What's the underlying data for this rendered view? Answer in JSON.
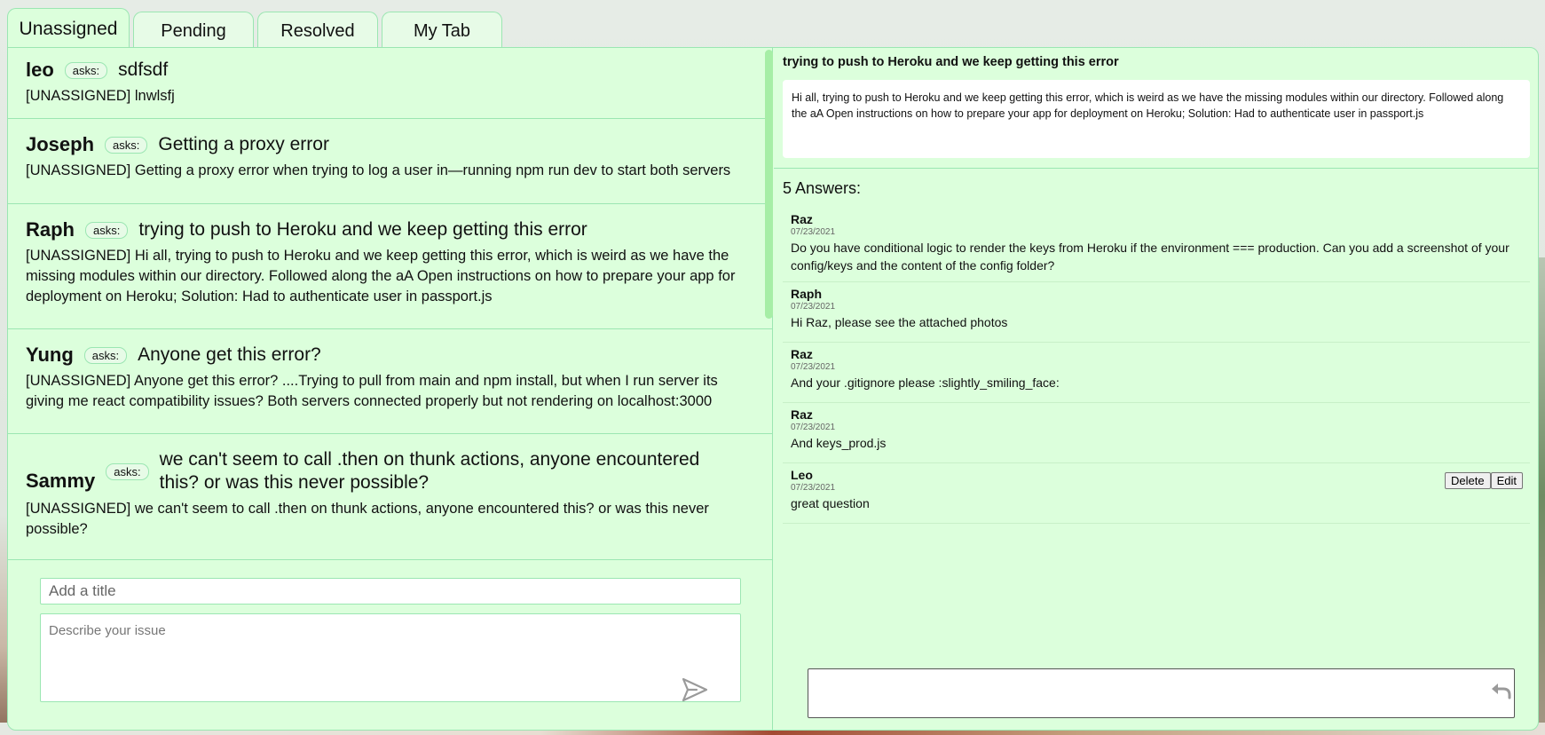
{
  "tabs": [
    {
      "label": "Unassigned",
      "active": true
    },
    {
      "label": "Pending"
    },
    {
      "label": "Resolved"
    },
    {
      "label": "My Tab"
    }
  ],
  "questions": [
    {
      "name": "leo",
      "asks": "asks:",
      "title": "sdfsdf",
      "body": "[UNASSIGNED] lnwlsfj"
    },
    {
      "name": "Joseph",
      "asks": "asks:",
      "title": "Getting a proxy error",
      "body": "[UNASSIGNED] Getting a proxy error when trying to log a user in—running npm run dev to start both servers"
    },
    {
      "name": "Raph",
      "asks": "asks:",
      "title": "trying to push to Heroku and we keep getting this error",
      "body": "[UNASSIGNED] Hi all, trying to push to Heroku and we keep getting this error, which is weird as we have the missing modules within our directory. Followed along the aA Open instructions on how to prepare your app for deployment on Heroku; Solution: Had to authenticate user in passport.js"
    },
    {
      "name": "Yung",
      "asks": "asks:",
      "title": "Anyone get this error?",
      "body": "[UNASSIGNED] Anyone get this error? ....Trying to pull from main and npm install, but when I run server its giving me react compatibility issues? Both servers connected properly but not rendering on localhost:3000"
    },
    {
      "name": "Sammy",
      "asks": "asks:",
      "title": "we can't seem to call .then on thunk actions, anyone encountered this? or was this never possible?",
      "body": "[UNASSIGNED] we can't seem to call .then on thunk actions, anyone encountered this? or was this never possible?"
    }
  ],
  "composer": {
    "title_placeholder": "Add a title",
    "desc_placeholder": "Describe your issue"
  },
  "detail": {
    "title": "trying to push to Heroku and we keep getting this error",
    "body": "Hi all, trying to push to Heroku and we keep getting this error, which is weird as we have the missing modules within our directory. Followed along the aA Open instructions on how to prepare your app for deployment on Heroku; Solution: Had to authenticate user in passport.js",
    "answer_count": "5 Answers:"
  },
  "answers": [
    {
      "name": "Raz",
      "date": "07/23/2021",
      "text": "Do you have conditional logic to render the keys from Heroku if the environment === production. Can you add a screenshot of your config/keys and the content of the config folder?"
    },
    {
      "name": "Raph",
      "date": "07/23/2021",
      "text": "Hi Raz, please see the attached photos"
    },
    {
      "name": "Raz",
      "date": "07/23/2021",
      "text": "And your .gitignore please :slightly_smiling_face:"
    },
    {
      "name": "Raz",
      "date": "07/23/2021",
      "text": "And keys_prod.js"
    },
    {
      "name": "Leo",
      "date": "07/23/2021",
      "text": "great question",
      "delete_label": "Delete",
      "edit_label": "Edit"
    }
  ],
  "icons": {
    "send": "send-icon",
    "reply": "reply-icon"
  },
  "colors": {
    "panel": "#dcffdc",
    "border": "#9be6b2",
    "scrollbar": "#a6eea6"
  }
}
